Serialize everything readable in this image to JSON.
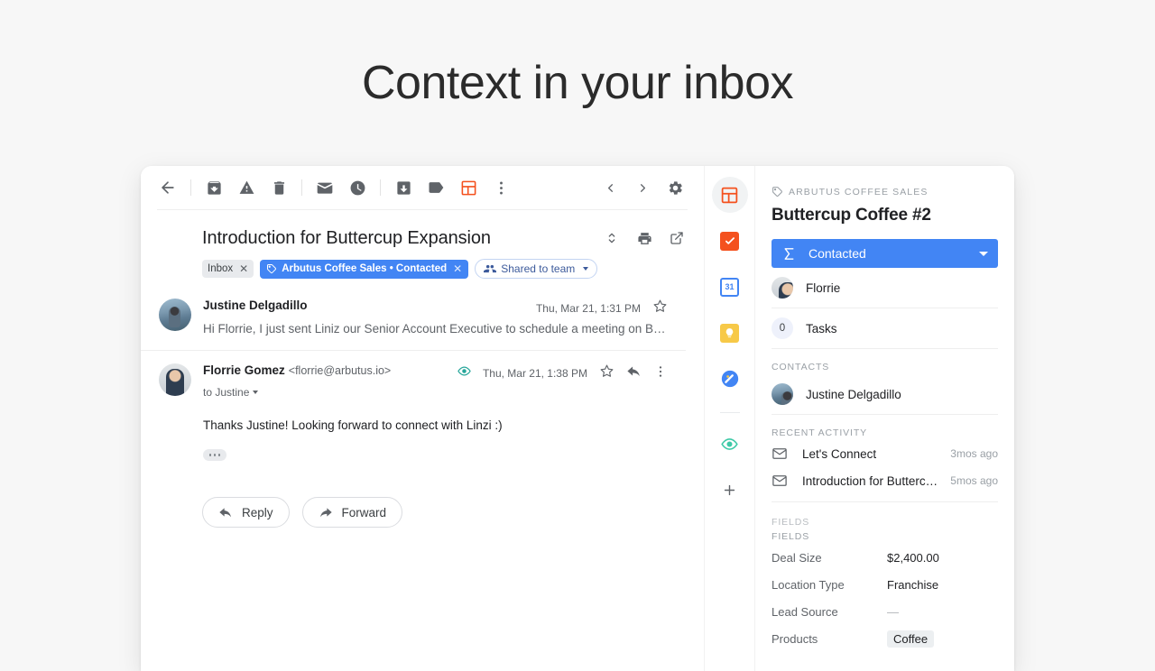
{
  "hero": {
    "headline": "Context in your inbox"
  },
  "toolbar": {
    "back": "Back",
    "items": [
      {
        "name": "archive-icon",
        "label": "Archive"
      },
      {
        "name": "report-spam-icon",
        "label": "Report spam"
      },
      {
        "name": "delete-icon",
        "label": "Delete"
      },
      {
        "name": "mark-unread-icon",
        "label": "Mark as unread"
      },
      {
        "name": "snooze-icon",
        "label": "Snooze"
      },
      {
        "name": "move-to-icon",
        "label": "Move to"
      },
      {
        "name": "labels-icon",
        "label": "Labels"
      },
      {
        "name": "streak-boxes-icon",
        "label": "Streak"
      },
      {
        "name": "more-options-icon",
        "label": "More"
      }
    ],
    "prev": "Newer",
    "next": "Older",
    "settings": "Settings"
  },
  "thread": {
    "subject": "Introduction for Buttercup Expansion",
    "actions": [
      {
        "name": "collapse-all-icon",
        "label": "Collapse all"
      },
      {
        "name": "print-icon",
        "label": "Print all"
      },
      {
        "name": "open-in-new-window-icon",
        "label": "In new window"
      }
    ],
    "chips": {
      "inbox": "Inbox",
      "streak_label": "Arbutus Coffee Sales • Contacted",
      "shared": "Shared to team"
    }
  },
  "messages": [
    {
      "sender": "Justine Delgadillo",
      "email": "",
      "date": "Thu, Mar 21, 1:31 PM",
      "snippet": "Hi Florrie, I just sent Liniz our Senior Account Executive to schedule a meeting on Butterc…",
      "collapsed": true
    },
    {
      "sender": "Florrie Gomez",
      "email": "<florrie@arbutus.io>",
      "to": "to Justine",
      "date": "Thu, Mar 21, 1:38 PM",
      "body": "Thanks Justine! Looking forward to connect with Linzi :)",
      "collapsed": false
    }
  ],
  "reply_actions": {
    "reply": "Reply",
    "forward": "Forward"
  },
  "rail": [
    {
      "name": "streak-addon-icon",
      "label": "Streak",
      "active": true
    },
    {
      "name": "google-tasks-icon",
      "label": "Tasks",
      "active": false
    },
    {
      "name": "google-calendar-icon",
      "label": "Calendar",
      "date": "31",
      "active": false
    },
    {
      "name": "google-keep-icon",
      "label": "Keep",
      "active": false
    },
    {
      "name": "google-contacts-icon",
      "label": "Contacts",
      "active": false
    },
    {
      "name": "read-receipt-icon",
      "label": "Read receipts",
      "active": false
    },
    {
      "name": "add-addon-icon",
      "label": "Get add-ons",
      "active": false
    }
  ],
  "crm": {
    "pipeline": "Arbutus Coffee Sales",
    "box_title": "Buttercup Coffee #2",
    "stage": "Contacted",
    "assignee": "Florrie",
    "tasks_label": "Tasks",
    "tasks_count": "0",
    "contacts_heading": "Contacts",
    "contacts": [
      {
        "name": "Justine Delgadillo"
      }
    ],
    "activity_heading": "Recent activity",
    "activity": [
      {
        "name": "Let's Connect",
        "when": "3mos ago"
      },
      {
        "name": "Introduction for Butterc…",
        "when": "5mos ago"
      }
    ],
    "fields_heading_ghost": "Fields",
    "fields_heading": "Fields",
    "fields": [
      {
        "key": "Deal Size",
        "value": "$2,400.00",
        "type": "text"
      },
      {
        "key": "Location Type",
        "value": "Franchise",
        "type": "text"
      },
      {
        "key": "Lead Source",
        "value": "—",
        "type": "empty"
      },
      {
        "key": "Products",
        "value": "Coffee",
        "type": "tag"
      }
    ]
  },
  "colors": {
    "streak_blue": "#4285f4",
    "streak_orange": "#f4511e",
    "read_teal": "#26a69a",
    "tasks_orange": "#f4511e",
    "calendar_blue": "#4285f4",
    "keep_yellow": "#f7c948"
  }
}
